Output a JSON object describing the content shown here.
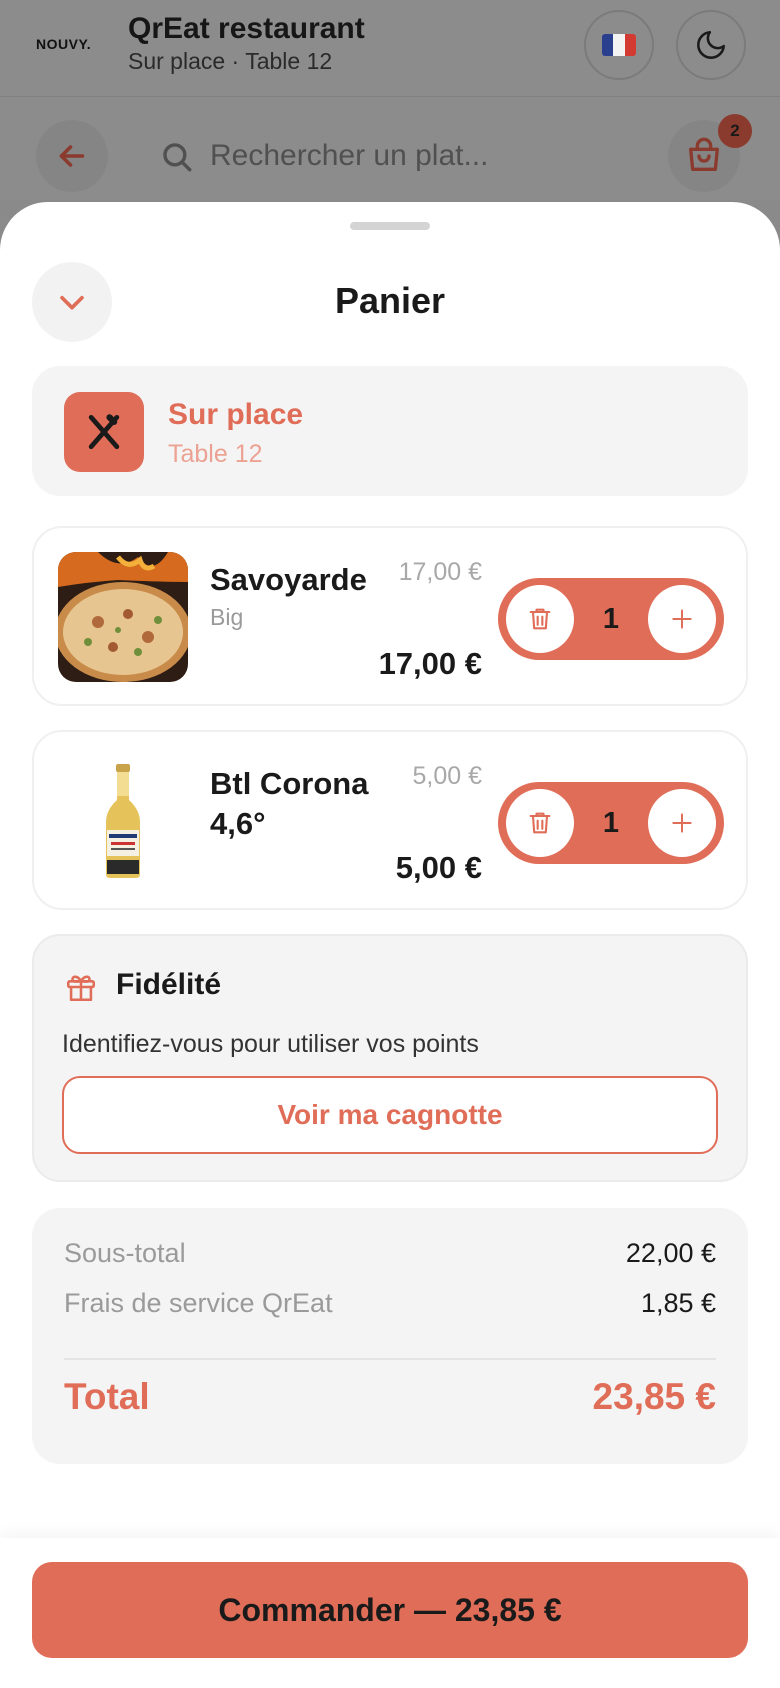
{
  "header": {
    "logo": "NOUVY.",
    "restaurant_name": "QrEat restaurant",
    "subtitle": "Sur place · Table 12"
  },
  "search": {
    "placeholder": "Rechercher un plat..."
  },
  "cart_badge": "2",
  "sheet": {
    "title": "Panier"
  },
  "service_mode": {
    "label": "Sur place",
    "table": "Table 12"
  },
  "items": [
    {
      "name": "Savoyarde",
      "variant": "Big",
      "unit_price": "17,00 €",
      "price": "17,00 €",
      "quantity": "1"
    },
    {
      "name": "Btl Corona 4,6°",
      "variant": "",
      "unit_price": "5,00 €",
      "price": "5,00 €",
      "quantity": "1"
    }
  ],
  "loyalty": {
    "title": "Fidélité",
    "description": "Identifiez-vous pour utiliser vos points",
    "button": "Voir ma cagnotte"
  },
  "summary": {
    "subtotal_label": "Sous-total",
    "subtotal_value": "22,00 €",
    "fee_label": "Frais de service QrEat",
    "fee_value": "1,85 €",
    "total_label": "Total",
    "total_value": "23,85 €"
  },
  "order_button": "Commander — 23,85 €",
  "colors": {
    "accent": "#e06d57",
    "overlay": "#8c8c8c"
  }
}
